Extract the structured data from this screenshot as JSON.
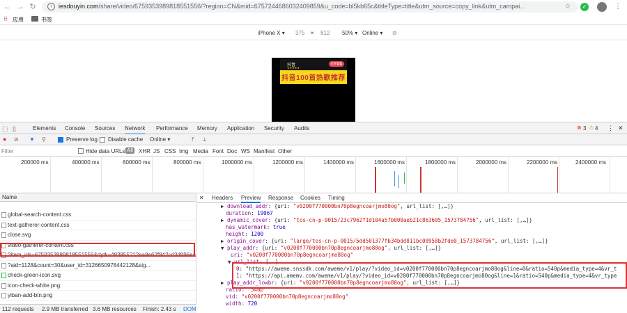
{
  "browser": {
    "url_host": "iesdouyin.com",
    "url_path": "/share/video/6759353989818551556/?region=CN&mid=6757244686032409859&u_code=bl5kb65c&titleType=title&utm_source=copy_link&utm_campai...",
    "bookmarks": [
      "应用",
      "书签"
    ]
  },
  "device_toolbar": {
    "device": "iPhone X ▾",
    "width": "375",
    "x": "×",
    "height": "812",
    "zoom": "50% ▾",
    "network": "Online ▾"
  },
  "page_banner": {
    "brand": "抖音",
    "button": "打开看看",
    "headline": "抖音100首热歌推荐"
  },
  "devtools": {
    "tabs": [
      "Elements",
      "Console",
      "Sources",
      "Network",
      "Performance",
      "Memory",
      "Application",
      "Security",
      "Audits"
    ],
    "active_tab": "Network",
    "errors": "3",
    "warnings": "4",
    "network_toolbar": {
      "preserve_log": "Preserve log",
      "disable_cache": "Disable cache",
      "throttle": "Online ▾"
    },
    "filter": {
      "placeholder": "Filter",
      "hide_data_urls": "Hide data URLs",
      "types": [
        "All",
        "XHR",
        "JS",
        "CSS",
        "Img",
        "Media",
        "Font",
        "Doc",
        "WS",
        "Manifest",
        "Other"
      ]
    },
    "timeline_ticks": [
      "200000 ms",
      "400000 ms",
      "600000 ms",
      "800000 ms",
      "1000000 ms",
      "1200000 ms",
      "1400000 ms",
      "1600000 ms",
      "1800000 ms",
      "2000000 ms",
      "2200000 ms",
      "2400000 ms"
    ],
    "list_header": "Name",
    "requests": [
      "global-search-content.css",
      "text-gatherer-content.css",
      "close.svg",
      "video-gatherer-content.css",
      "?item_ids=6759353989818551556&dytk=483855212ea8e62f842cd3d996ea...",
      "?aid=1128&count=30&user_id=3126650978442128&sig...",
      "check-green-icon.svg",
      "icon-check-white.png",
      "yiban-add-btn.png"
    ],
    "status": {
      "requests": "112 requests",
      "transferred": "2.9 MB transferred",
      "resources": "3.6 MB resources",
      "finish": "Finish: 2.43 s",
      "dom": "DOM"
    },
    "preview_tabs": [
      "Headers",
      "Preview",
      "Response",
      "Cookies",
      "Timing"
    ],
    "active_preview_tab": "Preview",
    "json_lines": [
      {
        "indent": 0,
        "text": "▶ download_addr: {uri: \"v0200f770000bn70p8egncoarjmo80og\", url_list: [,…]}"
      },
      {
        "indent": 1,
        "text": "duration: 19067"
      },
      {
        "indent": 0,
        "text": "▶ dynamic_cover: {uri: \"tos-cn-p-0015/23c7962f1d104a57b000aeb21c863605_1573784756\", url_list: [,…]}"
      },
      {
        "indent": 1,
        "text": "has_watermark: true"
      },
      {
        "indent": 1,
        "text": "height: 1200"
      },
      {
        "indent": 0,
        "text": "▶ origin_cover: {uri: \"large/tos-cn-p-0015/5dd501377fb34bdd811bc00958b2fde0_1573784756\", url_list: [,…]}"
      },
      {
        "indent": 0,
        "text": "▼ play_addr: {uri: \"v0200f770000bn70p8egncoarjmo80og\", url_list: [,…]}"
      },
      {
        "indent": 2,
        "text": "uri: \"v0200f770000bn70p8egncoarjmo80og\""
      },
      {
        "indent": 2,
        "text": "▼ url_list: [,…]"
      },
      {
        "indent": 3,
        "text": "0: \"https://aweme.snssdk.com/aweme/v1/play/?video_id=v0200f770000bn70p8egncoarjmo80og&line=0&ratio=540p&media_type=4&vr_t"
      },
      {
        "indent": 3,
        "text": "1: \"https://api.amemv.com/aweme/v1/play/?video_id=v0200f770000bn70p8egncoarjmo80og&line=1&ratio=540p&media_type=4&vr_type"
      },
      {
        "indent": 0,
        "text": "▶ play_addr_lowbr: {uri: \"v0200f770000bn70p8egncoarjmo80og\", url_list: [,…]}"
      },
      {
        "indent": 1,
        "text": "ratio: \"540p\""
      },
      {
        "indent": 1,
        "text": "vid: \"v0200f770000bn70p8egncoarjmo80og\""
      },
      {
        "indent": 1,
        "text": "width: 720"
      }
    ]
  }
}
